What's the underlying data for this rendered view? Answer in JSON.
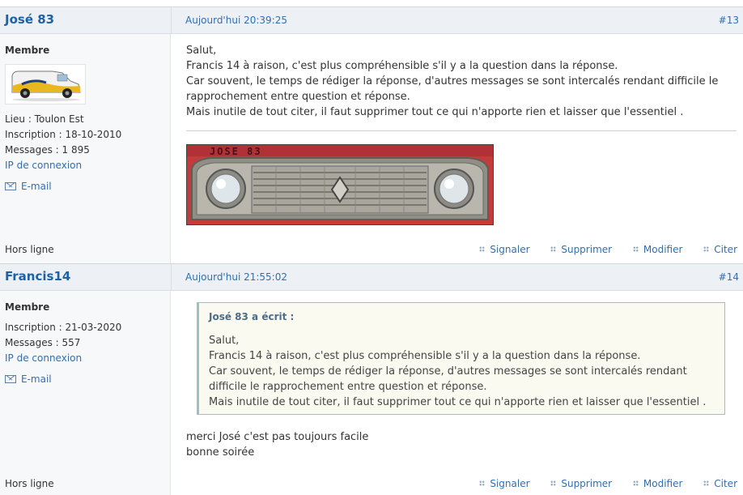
{
  "posts": [
    {
      "author": "José 83",
      "date": "Aujourd'hui 20:39:25",
      "number": "#13",
      "rank": "Membre",
      "info": {
        "location": "Lieu : Toulon Est",
        "registration": "Inscription : 18-10-2010",
        "messages": "Messages : 1 895"
      },
      "ip_link": "IP de connexion",
      "email_label": "E-mail",
      "status": "Hors ligne",
      "message_lines": [
        "Salut,",
        "Francis 14 à raison, c'est plus compréhensible s'il y a la question dans la réponse.",
        "Car souvent, le temps de rédiger la réponse, d'autres messages se sont intercalés rendant difficile le",
        "rapprochement entre question et réponse.",
        "Mais inutile de tout citer, il faut supprimer tout ce qui n'apporte rien et laisser que l'essentiel ."
      ],
      "signature_label": "JOSE 83"
    },
    {
      "author": "Francis14",
      "date": "Aujourd'hui 21:55:02",
      "number": "#14",
      "rank": "Membre",
      "info": {
        "registration": "Inscription : 21-03-2020",
        "messages": "Messages : 557"
      },
      "ip_link": "IP de connexion",
      "email_label": "E-mail",
      "status": "Hors ligne",
      "quote": {
        "author": "José 83 a écrit :",
        "lines": [
          "Salut,",
          "Francis 14 à raison, c'est plus compréhensible s'il y a la question dans la réponse.",
          "Car souvent, le temps de rédiger la réponse, d'autres messages se sont intercalés rendant",
          "difficile le rapprochement entre question et réponse.",
          "Mais inutile de tout citer, il faut supprimer tout ce qui n'apporte rien et laisser que l'essentiel ."
        ]
      },
      "message_lines": [
        "merci José c'est pas toujours facile",
        "bonne soirée"
      ]
    }
  ],
  "actions": {
    "report": "Signaler",
    "delete": "Supprimer",
    "edit": "Modifier",
    "quote": "Citer"
  },
  "colors": {
    "link": "#2f6fb2",
    "author": "#1d62a8",
    "header_bg": "#edf1f5",
    "quote_border": "#9fbfc0"
  }
}
